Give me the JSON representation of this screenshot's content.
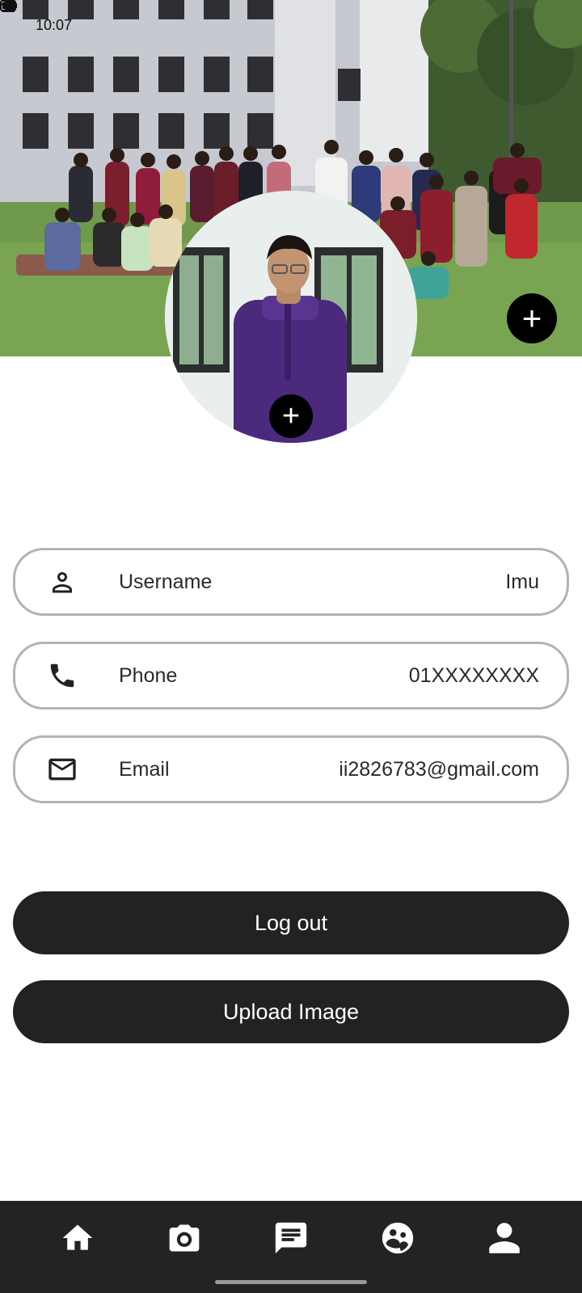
{
  "status_bar": {
    "time": "10:07"
  },
  "profile": {
    "cover_add_label": "+",
    "avatar_add_label": "+"
  },
  "fields": [
    {
      "icon": "person-icon",
      "label": "Username",
      "value": "Imu"
    },
    {
      "icon": "phone-icon",
      "label": "Phone",
      "value": "01XXXXXXXX"
    },
    {
      "icon": "mail-icon",
      "label": "Email",
      "value": "ii2826783@gmail.com"
    }
  ],
  "buttons": {
    "logout_label": "Log out",
    "upload_label": "Upload Image"
  },
  "bottom_nav": {
    "items": [
      "home-icon",
      "camera-icon",
      "chat-icon",
      "groups-icon",
      "profile-icon"
    ]
  },
  "colors": {
    "button_bg": "#222222",
    "nav_bg": "#232323",
    "field_border": "#b3b3b3"
  }
}
